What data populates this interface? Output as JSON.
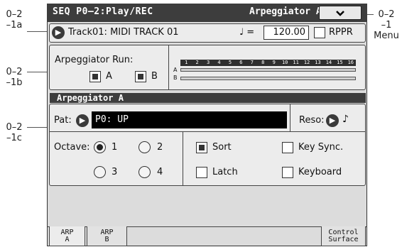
{
  "callouts": {
    "left_a_1": "0–2",
    "left_a_2": "–1a",
    "left_b_1": "0–2",
    "left_b_2": "–1b",
    "left_c_1": "0–2",
    "left_c_2": "–1c",
    "right_1": "0–2",
    "right_2": "–1",
    "right_3": "Menu"
  },
  "header": {
    "title": "SEQ P0–2:Play/REC",
    "page_name": "Arpeggiator A",
    "menu_icon": "chevron-down-icon"
  },
  "track": {
    "name": "Track01: MIDI TRACK 01",
    "tempo_symbol": "♩ =",
    "tempo": "120.00",
    "rppr_label": "RPPR",
    "rppr_checked": false
  },
  "arp_run": {
    "label": "Arpeggiator Run:",
    "a_label": "A",
    "b_label": "B",
    "a_checked": true,
    "b_checked": true,
    "steps": [
      "1",
      "2",
      "3",
      "4",
      "5",
      "6",
      "7",
      "8",
      "9",
      "10",
      "11",
      "12",
      "13",
      "14",
      "15",
      "16"
    ],
    "row_a": "A",
    "row_b": "B"
  },
  "arpeggiator": {
    "section_title": "Arpeggiator A",
    "pat_label": "Pat:",
    "pattern": "P0: UP",
    "reso_label": "Reso:",
    "reso_value": "♪",
    "octave_label": "Octave:",
    "octaves": [
      "1",
      "2",
      "3",
      "4"
    ],
    "octave_selected": "1",
    "sort_label": "Sort",
    "sort_checked": true,
    "key_sync_label": "Key Sync.",
    "key_sync_checked": false,
    "latch_label": "Latch",
    "latch_checked": false,
    "keyboard_label": "Keyboard",
    "keyboard_checked": false
  },
  "tabs": {
    "arp_a_1": "ARP",
    "arp_a_2": "A",
    "arp_b_1": "ARP",
    "arp_b_2": "B",
    "control_1": "Control",
    "control_2": "Surface"
  }
}
